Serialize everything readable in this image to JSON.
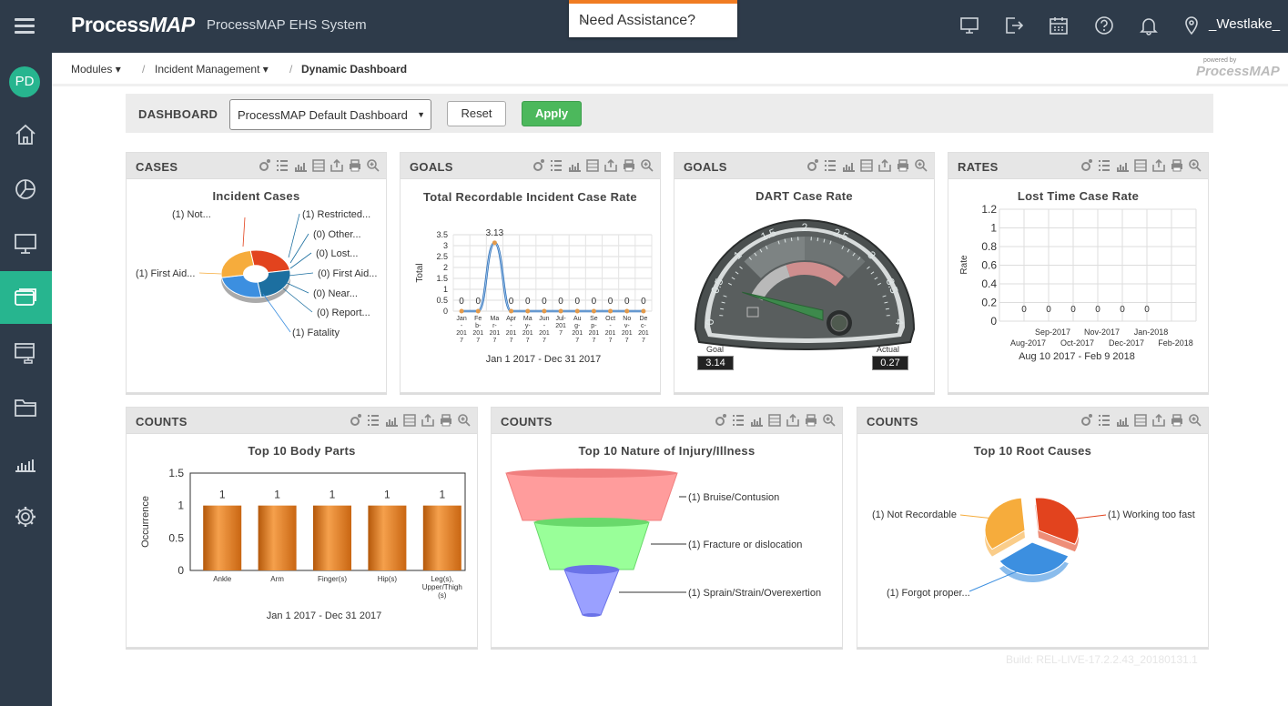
{
  "app": {
    "title": "ProcessMAP EHS System",
    "user": "_Westlake_",
    "logo_plain": "Process",
    "logo_bold": "MAP",
    "assist": "Need Assistance?",
    "avatar": "PD"
  },
  "topbar": {
    "icons": [
      "monitor-icon",
      "logout-icon",
      "calendar-icon",
      "help-icon",
      "bell-icon",
      "location-icon"
    ]
  },
  "sidebar": {
    "items": [
      "home-icon",
      "chart-icon",
      "monitor-icon",
      "window-icon",
      "sitemap-icon",
      "folder-icon",
      "bar-chart-icon",
      "settings-icon"
    ],
    "active_index": 3,
    "active_color": "#27b58f"
  },
  "breadcrumb": {
    "items": [
      "Modules",
      "Incident Management",
      "Dynamic Dashboard"
    ]
  },
  "powered": {
    "top": "powered by",
    "brand": "ProcessMAP"
  },
  "filter": {
    "label": "DASHBOARD",
    "selected": "ProcessMAP Default Dashboard",
    "reset": "Reset",
    "apply": "Apply"
  },
  "build": "Build: REL-LIVE-17.2.2.43_20180131.1",
  "panels": {
    "cases": {
      "header": "CASES",
      "title": "Incident Cases",
      "labels": [
        "(1) Not...",
        "(1) Restricted...",
        "(0) Other...",
        "(0) Lost...",
        "(0) First Aid...",
        "(0) Near...",
        "(0) Report...",
        "(1) Fatality",
        "(1) First Aid..."
      ]
    },
    "goals1": {
      "header": "GOALS",
      "title": "Total Recordable Incident Case Rate",
      "ylabel": "Total",
      "range": "Jan 1 2017 - Dec 31 2017"
    },
    "goals2": {
      "header": "GOALS",
      "title": "DART Case Rate",
      "goal_label": "Goal",
      "goal_value": "3.14",
      "actual_label": "Actual",
      "actual_value": "0.27"
    },
    "rates": {
      "header": "RATES",
      "title": "Lost Time Case Rate",
      "ylabel": "Rate",
      "range": "Aug 10 2017 - Feb 9 2018"
    },
    "counts1": {
      "header": "COUNTS",
      "title": "Top 10 Body Parts",
      "ylabel": "Occurrence",
      "range": "Jan 1 2017 - Dec 31 2017"
    },
    "counts2": {
      "header": "COUNTS",
      "title": "Top 10 Nature of Injury/Illness",
      "labels": [
        "(1) Bruise/Contusion",
        "(1) Fracture or dislocation",
        "(1) Sprain/Strain/Overexertion"
      ]
    },
    "counts3": {
      "header": "COUNTS",
      "title": "Top 10 Root Causes",
      "labels": [
        "(1) Not Recordable",
        "(1) Working too fast",
        "(1) Forgot proper..."
      ]
    }
  },
  "chart_data": [
    {
      "type": "pie",
      "title": "Incident Cases",
      "categories": [
        "Not...",
        "Restricted...",
        "Other...",
        "Lost...",
        "First Aid...",
        "Near...",
        "Report...",
        "Fatality",
        "First Aid..."
      ],
      "values": [
        1,
        1,
        0,
        0,
        0,
        0,
        0,
        1,
        1
      ]
    },
    {
      "type": "line",
      "title": "Total Recordable Incident Case Rate",
      "xlabel": "",
      "ylabel": "Total",
      "categories": [
        "Jan-2017",
        "Feb-2017",
        "Mar-2017",
        "Apr-2017",
        "May-2017",
        "Jun-2017",
        "Jul-2017",
        "Aug-2017",
        "Sep-2017",
        "Oct-2017",
        "Nov-2017",
        "Dec-2017"
      ],
      "ticklabels": [
        [
          "Jan",
          "-",
          "201",
          "7"
        ],
        [
          "Fe",
          "b-",
          "201",
          "7"
        ],
        [
          "Ma",
          "r-",
          "201",
          "7"
        ],
        [
          "Apr",
          "-",
          "201",
          "7"
        ],
        [
          "Ma",
          "y-",
          "201",
          "7"
        ],
        [
          "Jun",
          "-",
          "201",
          "7"
        ],
        [
          "Jul-",
          "201",
          "7"
        ],
        [
          "Au",
          "g-",
          "201",
          "7"
        ],
        [
          "Se",
          "p-",
          "201",
          "7"
        ],
        [
          "Oct",
          "-",
          "201",
          "7"
        ],
        [
          "No",
          "v-",
          "201",
          "7"
        ],
        [
          "De",
          "c-",
          "201",
          "7"
        ]
      ],
      "values": [
        0,
        0,
        3.13,
        0,
        0,
        0,
        0,
        0,
        0,
        0,
        0,
        0
      ],
      "ylim": [
        0,
        3.5
      ],
      "yticks": [
        "0",
        "0.5",
        "1",
        "1.5",
        "2",
        "2.5",
        "3",
        "3.5"
      ]
    },
    {
      "type": "gauge",
      "title": "DART Case Rate",
      "range": [
        0,
        4
      ],
      "ticks": [
        "0",
        "0.5",
        "1",
        "1.5",
        "2",
        "2.5",
        "3",
        "3.5",
        "4"
      ],
      "goal": 3.14,
      "actual": 0.27
    },
    {
      "type": "line",
      "title": "Lost Time Case Rate",
      "ylabel": "Rate",
      "categories": [
        "Aug-2017",
        "Sep-2017",
        "Oct-2017",
        "Nov-2017",
        "Dec-2017",
        "Jan-2018",
        "Feb-2018"
      ],
      "values": [
        0,
        0,
        0,
        0,
        0,
        0
      ],
      "ylim": [
        0,
        1.2
      ],
      "yticks": [
        "0",
        "0.2",
        "0.4",
        "0.6",
        "0.8",
        "1",
        "1.2"
      ]
    },
    {
      "type": "bar",
      "title": "Top 10 Body Parts",
      "ylabel": "Occurrence",
      "categories": [
        "Ankle",
        "Arm",
        "Finger(s)",
        "Hip(s)",
        "Leg(s), Upper/Thigh (s)"
      ],
      "catlines": [
        [
          "Ankle"
        ],
        [
          "Arm"
        ],
        [
          "Finger(s)"
        ],
        [
          "Hip(s)"
        ],
        [
          "Leg(s),",
          "Upper/Thigh",
          "(s)"
        ]
      ],
      "values": [
        1,
        1,
        1,
        1,
        1
      ],
      "ylim": [
        0,
        1.5
      ],
      "yticks": [
        "0",
        "0.5",
        "1",
        "1.5"
      ]
    },
    {
      "type": "funnel",
      "title": "Top 10 Nature of Injury/Illness",
      "categories": [
        "Bruise/Contusion",
        "Fracture or dislocation",
        "Sprain/Strain/Overexertion"
      ],
      "values": [
        1,
        1,
        1
      ]
    },
    {
      "type": "pie",
      "title": "Top 10 Root Causes",
      "categories": [
        "Working too fast",
        "Forgot proper...",
        "Not Recordable"
      ],
      "values": [
        1,
        1,
        1
      ]
    }
  ]
}
